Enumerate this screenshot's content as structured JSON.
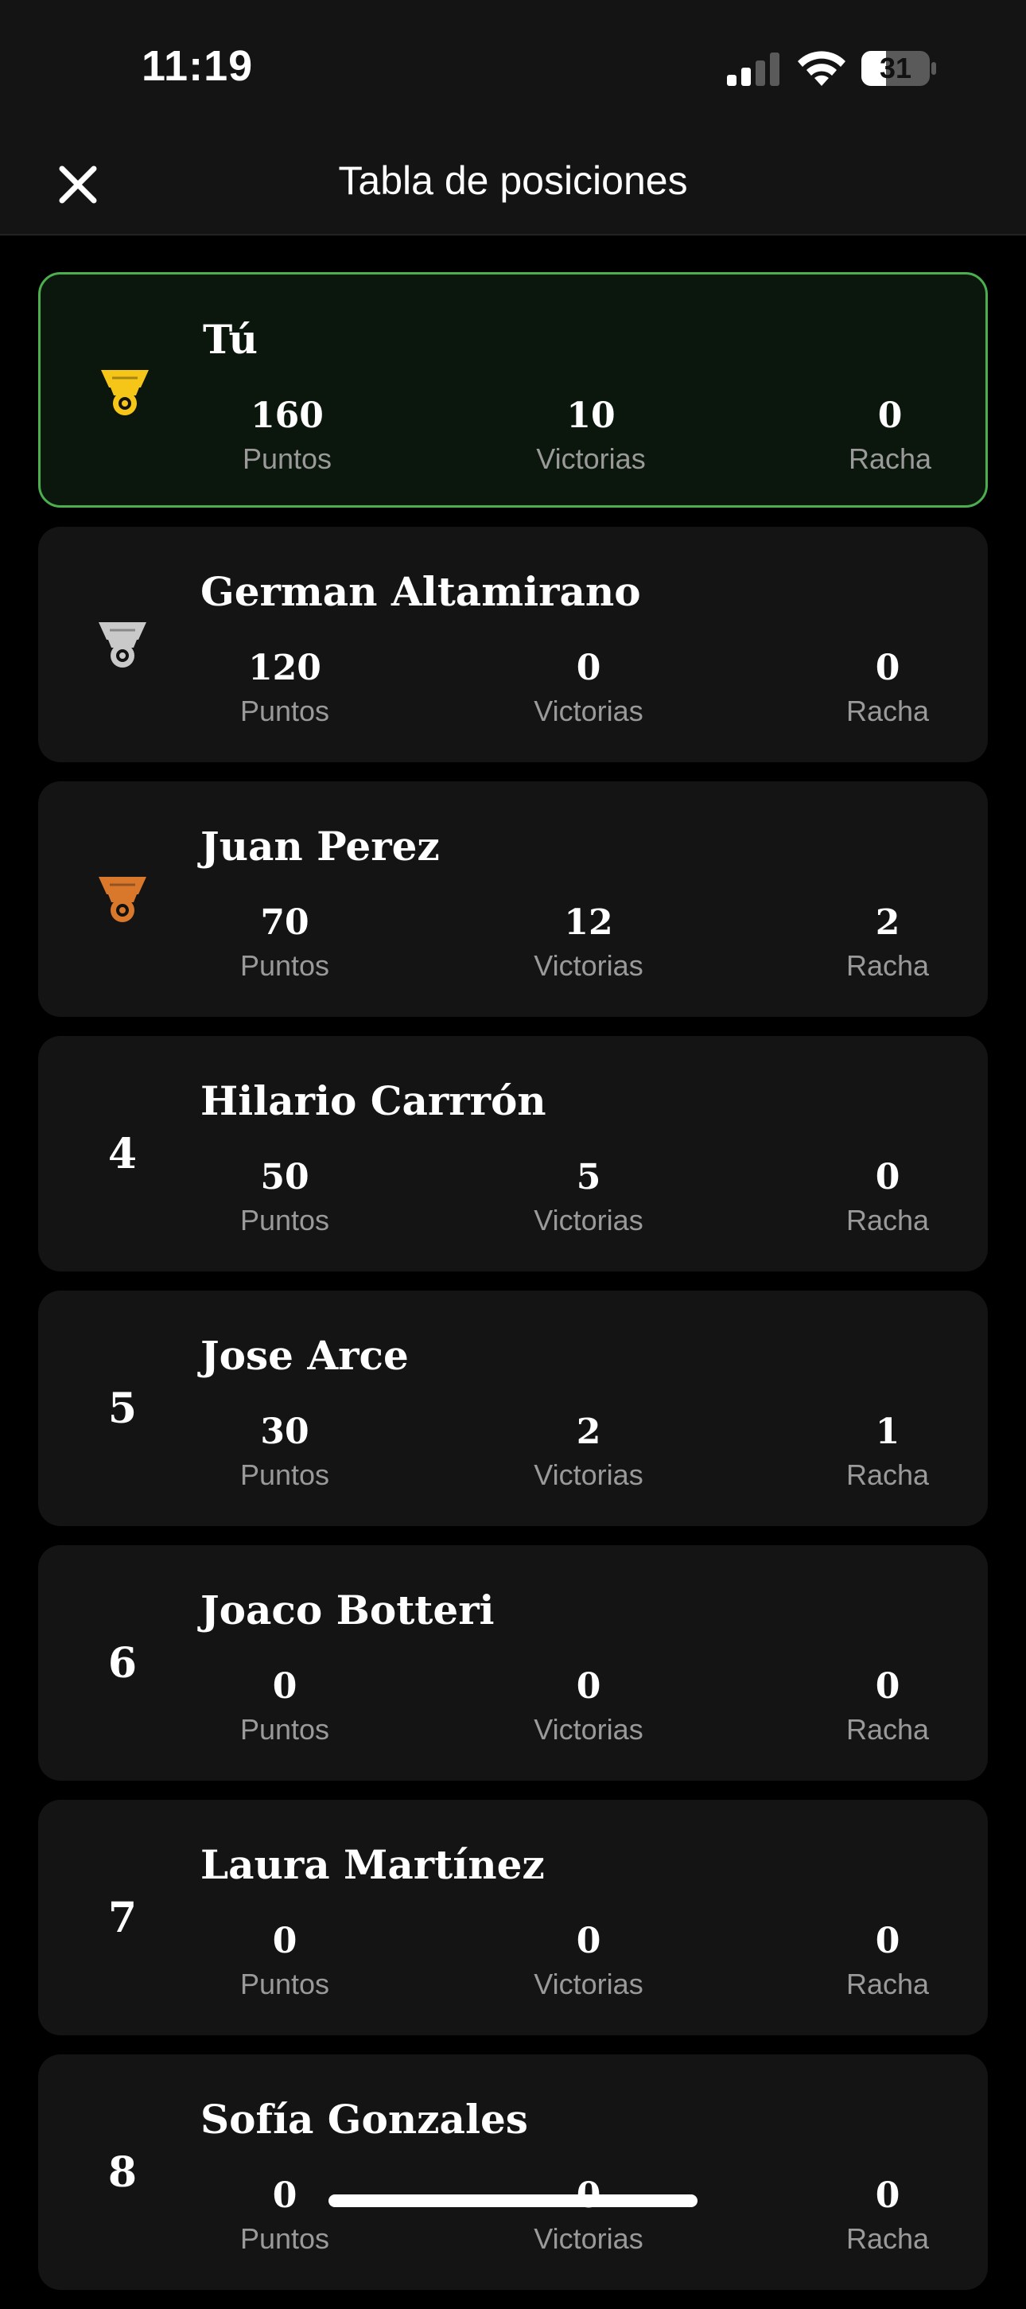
{
  "status_bar": {
    "time": "11:19",
    "battery": "31",
    "icons": [
      "signal-icon",
      "wifi-icon",
      "battery-icon"
    ]
  },
  "header": {
    "title": "Tabla de posiciones",
    "close_icon": "close-icon"
  },
  "colors": {
    "background": "#000000",
    "card": "#141414",
    "highlight_border": "#4cae4f",
    "highlight_bg": "#0b160c",
    "gold": "#f5c518",
    "silver": "#c9c9c9",
    "bronze": "#d9772b",
    "muted_text": "#9a9a9a"
  },
  "labels": {
    "points": "Puntos",
    "wins": "Victorias",
    "streak": "Racha"
  },
  "players": [
    {
      "rank": "1",
      "medal": "gold",
      "name": "Tú",
      "points": "160",
      "wins": "10",
      "streak": "0",
      "is_me": true
    },
    {
      "rank": "2",
      "medal": "silver",
      "name": "German Altamirano",
      "points": "120",
      "wins": "0",
      "streak": "0"
    },
    {
      "rank": "3",
      "medal": "bronze",
      "name": "Juan Perez",
      "points": "70",
      "wins": "12",
      "streak": "2"
    },
    {
      "rank": "4",
      "name": "Hilario Carrrón",
      "points": "50",
      "wins": "5",
      "streak": "0"
    },
    {
      "rank": "5",
      "name": "Jose Arce",
      "points": "30",
      "wins": "2",
      "streak": "1"
    },
    {
      "rank": "6",
      "name": "Joaco Botteri",
      "points": "0",
      "wins": "0",
      "streak": "0"
    },
    {
      "rank": "7",
      "name": "Laura Martínez",
      "points": "0",
      "wins": "0",
      "streak": "0"
    },
    {
      "rank": "8",
      "name": "Sofía Gonzales",
      "points": "0",
      "wins": "0",
      "streak": "0"
    }
  ]
}
